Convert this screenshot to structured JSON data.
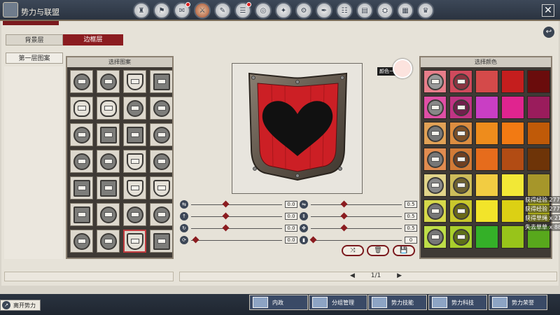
{
  "window": {
    "title": "势力与联盟",
    "close_label": "✕",
    "back_label": "↩"
  },
  "top_icons": [
    {
      "name": "top-tab-1-icon",
      "active": false,
      "badge": false
    },
    {
      "name": "top-tab-2-icon",
      "active": false,
      "badge": false
    },
    {
      "name": "top-tab-3-icon",
      "active": false,
      "badge": true
    },
    {
      "name": "top-tab-4-icon",
      "active": true,
      "badge": false
    },
    {
      "name": "top-tab-5-icon",
      "active": false,
      "badge": false
    },
    {
      "name": "top-tab-6-icon",
      "active": false,
      "badge": true
    },
    {
      "name": "top-tab-7-icon",
      "active": false,
      "badge": false
    },
    {
      "name": "top-tab-8-icon",
      "active": false,
      "badge": false
    },
    {
      "name": "top-tab-9-icon",
      "active": false,
      "badge": false
    },
    {
      "name": "top-tab-10-icon",
      "active": false,
      "badge": false
    },
    {
      "name": "top-tab-11-icon",
      "active": false,
      "badge": false
    },
    {
      "name": "top-tab-12-icon",
      "active": false,
      "badge": false
    },
    {
      "name": "top-tab-13-icon",
      "active": false,
      "badge": false
    },
    {
      "name": "top-tab-14-icon",
      "active": false,
      "badge": false
    },
    {
      "name": "top-tab-15-icon",
      "active": false,
      "badge": false
    }
  ],
  "layers": {
    "background_layer": "背景层",
    "border_layer": "边框层",
    "first_pattern_layer": "第一层图案"
  },
  "pattern_panel": {
    "header": "选择图案",
    "rows": [
      [
        "round",
        "round",
        "shield",
        "square"
      ],
      [
        "scallop",
        "scallop",
        "round",
        "round"
      ],
      [
        "round",
        "square",
        "square",
        "round"
      ],
      [
        "round",
        "round",
        "shield",
        "round"
      ],
      [
        "square",
        "square",
        "shield",
        "shield"
      ],
      [
        "square",
        "round",
        "round",
        "round"
      ],
      [
        "round",
        "round",
        "shield",
        "square"
      ]
    ],
    "selected_index": 26
  },
  "color_chip": {
    "label": "颜色一",
    "color": "#fce3de"
  },
  "sliders_left": [
    {
      "icon": "⇆",
      "value": "0.0",
      "pos": 0.35
    },
    {
      "icon": "↑",
      "value": "0.0",
      "pos": 0.35
    },
    {
      "icon": "↻",
      "value": "0.0",
      "pos": 0.35
    },
    {
      "icon": "⟳",
      "value": "0.0",
      "pos": 0.02
    }
  ],
  "sliders_right": [
    {
      "icon": "⇋",
      "value": "0.5",
      "pos": 0.34
    },
    {
      "icon": "⇕",
      "value": "0.5",
      "pos": 0.34
    },
    {
      "icon": "✥",
      "value": "0.5",
      "pos": 0.34
    },
    {
      "icon": "▮",
      "value": "0",
      "pos": 0.0
    }
  ],
  "tool_buttons": [
    {
      "name": "flip-tool-button",
      "label": "⤨"
    },
    {
      "name": "delete-tool-button",
      "label": "🗑"
    },
    {
      "name": "save-tool-button",
      "label": "💾"
    }
  ],
  "color_panel": {
    "header": "选择颜色",
    "rows": [
      [
        {
          "c": "#e77e8a",
          "s": "#999"
        },
        {
          "c": "#d04a5c",
          "s": "#8a3440"
        },
        {
          "c": "#d44a4a"
        },
        {
          "c": "#c51e1e"
        },
        {
          "c": "#6a0c0c"
        }
      ],
      [
        {
          "c": "#e04fa6",
          "s": "#888"
        },
        {
          "c": "#c03484",
          "s": "#70204c"
        },
        {
          "c": "#c93ec4"
        },
        {
          "c": "#e0248f"
        },
        {
          "c": "#9a1c5c"
        }
      ],
      [
        {
          "c": "#e1a156",
          "s": "#777"
        },
        {
          "c": "#dc8d40",
          "s": "#7c5028"
        },
        {
          "c": "#ee8c1c"
        },
        {
          "c": "#f27a13"
        },
        {
          "c": "#c05a08"
        }
      ],
      [
        {
          "c": "#e18c50",
          "s": "#777"
        },
        {
          "c": "#d17a36",
          "s": "#704022"
        },
        {
          "c": "#e66c1c"
        },
        {
          "c": "#b24c14"
        },
        {
          "c": "#6e3408"
        }
      ],
      [
        {
          "c": "#e2d48a",
          "s": "#888"
        },
        {
          "c": "#cdbc5a",
          "s": "#6e6230"
        },
        {
          "c": "#f2cc42"
        },
        {
          "c": "#f2e836"
        },
        {
          "c": "#a6962a"
        }
      ],
      [
        {
          "c": "#d6d84a",
          "s": "#777"
        },
        {
          "c": "#c9c82c",
          "s": "#6a6818"
        },
        {
          "c": "#f2e42a"
        },
        {
          "c": "#dcd014"
        },
        {
          "c": "#a8a818"
        }
      ],
      [
        {
          "c": "#bede48",
          "s": "#777"
        },
        {
          "c": "#a9cf2c",
          "s": "#5e7018"
        },
        {
          "c": "#34b028"
        },
        {
          "c": "#98c41a"
        },
        {
          "c": "#58a81c"
        }
      ]
    ]
  },
  "side_feed": [
    "获得经验 277",
    "获得经验 277",
    "获得草绳 x 21",
    "失去草草 x 88"
  ],
  "pager": {
    "prev": "◀",
    "page": "1/1",
    "next": "▶"
  },
  "leave_force": "离开势力",
  "bottom_buttons": [
    {
      "name": "internal-affairs-button",
      "label": "内政"
    },
    {
      "name": "group-management-button",
      "label": "分组管理"
    },
    {
      "name": "force-skills-button",
      "label": "势力技能"
    },
    {
      "name": "force-tech-button",
      "label": "势力科技"
    },
    {
      "name": "force-honor-button",
      "label": "势力荣誉"
    }
  ],
  "shield": {
    "field_color": "#cc1f25",
    "charge_color": "#111111",
    "charge": "heart",
    "border": "wood"
  }
}
